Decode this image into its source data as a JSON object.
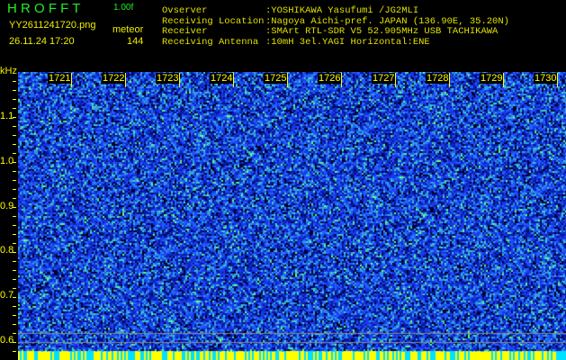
{
  "header": {
    "app_title": "H R O F F T",
    "version": "1.00f",
    "filename": "YY2611241720.png",
    "datetime": "26.11.24 17:20",
    "mode": "meteor",
    "count": "144",
    "info": [
      {
        "label": "Ovserver",
        "value": ":YOSHIKAWA Yasufumi /JG2MLI"
      },
      {
        "label": "Receiving Location",
        "value": ":Nagoya Aichi-pref. JAPAN (136.90E, 35.20N)"
      },
      {
        "label": "Receiver",
        "value": ":SMArt RTL-SDR V5 52.905MHz USB TACHIKAWA"
      },
      {
        "label": "Receiving Antenna",
        "value": ":10mH 3el.YAGI Horizontal:ENE"
      }
    ]
  },
  "spectrogram": {
    "y_unit": "kHz",
    "y_ticks": [
      "1.1",
      "1.0",
      "0.9",
      "0.8",
      "0.7",
      "0.6"
    ],
    "time_labels": [
      "1721",
      "1722",
      "1723",
      "1724",
      "1725",
      "1726",
      "1727",
      "1728",
      "1729",
      "1730"
    ],
    "colors": {
      "background": "#1030d0",
      "noise": "#40a0ff",
      "bottom_band": "#00e0ff",
      "bottom_signal": "#ffff00"
    }
  }
}
